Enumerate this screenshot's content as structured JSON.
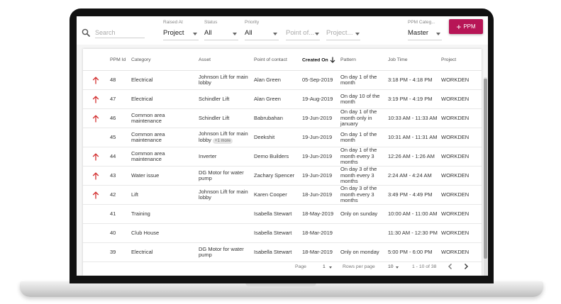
{
  "toolbar": {
    "search_placeholder": "Search",
    "filters": [
      {
        "label": "Raised At",
        "value": "Project"
      },
      {
        "label": "Status",
        "value": "All"
      },
      {
        "label": "Priority",
        "value": "All"
      },
      {
        "label": "",
        "value": "Point of..."
      },
      {
        "label": "",
        "value": "Project..."
      },
      {
        "label": "PPM Categ...",
        "value": "Master"
      }
    ],
    "add_button_label": "PPM"
  },
  "table": {
    "columns": [
      "",
      "PPM Id",
      "Category",
      "Asset",
      "Point of contact",
      "Created On",
      "Pattern",
      "Job Time",
      "Project"
    ],
    "sorted_column": "Created On",
    "rows": [
      {
        "flag": true,
        "id": "48",
        "category": "Electrical",
        "asset": "Johnson Lift for main lobby",
        "asset_more": "",
        "contact": "Alan Green",
        "created": "05-Sep-2019",
        "pattern": "On day 1 of the month",
        "job_time": "3:18 PM - 4:18 PM",
        "project": "WORKDEN"
      },
      {
        "flag": true,
        "id": "47",
        "category": "Electrical",
        "asset": "Schindler Lift",
        "asset_more": "",
        "contact": "Alan Green",
        "created": "19-Aug-2019",
        "pattern": "On day 10 of the month",
        "job_time": "3:19 PM - 4:19 PM",
        "project": "WORKDEN"
      },
      {
        "flag": true,
        "id": "46",
        "category": "Common area maintenance",
        "asset": "Schindler Lift",
        "asset_more": "",
        "contact": "Babrubahan",
        "created": "19-Jun-2019",
        "pattern": "On day 1 of the month only in january",
        "job_time": "10:33 AM - 11:33 AM",
        "project": "WORKDEN"
      },
      {
        "flag": false,
        "id": "45",
        "category": "Common area maintenance",
        "asset": "Johnson Lift for main lobby",
        "asset_more": "+1 more",
        "contact": "Deekshit",
        "created": "19-Jun-2019",
        "pattern": "On day 1 of the month",
        "job_time": "10:31 AM - 11:31 AM",
        "project": "WORKDEN"
      },
      {
        "flag": true,
        "id": "44",
        "category": "Common area maintenance",
        "asset": "Inverter",
        "asset_more": "",
        "contact": "Demo Builders",
        "created": "19-Jun-2019",
        "pattern": "On day 1 of the month every 3 months",
        "job_time": "12:26 AM - 1:26 AM",
        "project": "WORKDEN"
      },
      {
        "flag": true,
        "id": "43",
        "category": "Water issue",
        "asset": "DG Motor for water pump",
        "asset_more": "",
        "contact": "Zachary Spencer",
        "created": "19-Jun-2019",
        "pattern": "On day 3 of the month every 3 months",
        "job_time": "2:24 AM - 4:24 AM",
        "project": "WORKDEN"
      },
      {
        "flag": true,
        "id": "42",
        "category": "Lift",
        "asset": "Johnson Lift for main lobby",
        "asset_more": "",
        "contact": "Karen Cooper",
        "created": "18-Jun-2019",
        "pattern": "On day 3 of the month every 3 months",
        "job_time": "3:49 PM - 4:49 PM",
        "project": "WORKDEN"
      },
      {
        "flag": false,
        "id": "41",
        "category": "Training",
        "asset": "",
        "asset_more": "",
        "contact": "Isabella Stewart",
        "created": "18-May-2019",
        "pattern": "Only on sunday",
        "job_time": "10:00 AM - 11:00 AM",
        "project": "WORKDEN"
      },
      {
        "flag": false,
        "id": "40",
        "category": "Club House",
        "asset": "",
        "asset_more": "",
        "contact": "Isabella Stewart",
        "created": "18-Mar-2019",
        "pattern": "",
        "job_time": "11:30 AM - 12:30 PM",
        "project": "WORKDEN"
      },
      {
        "flag": false,
        "id": "39",
        "category": "Electrical",
        "asset": "DG Motor for water pump",
        "asset_more": "",
        "contact": "Isabella Stewart",
        "created": "18-Mar-2019",
        "pattern": "Only on monday",
        "job_time": "5:00 PM - 6:00 PM",
        "project": "WORKDEN"
      }
    ]
  },
  "pagination": {
    "page_label": "Page",
    "page_value": "1",
    "rows_label": "Rows per page",
    "rows_value": "10",
    "range": "1 - 10 of 38"
  },
  "colors": {
    "accent": "#b71556",
    "flag": "#d32f2f"
  }
}
